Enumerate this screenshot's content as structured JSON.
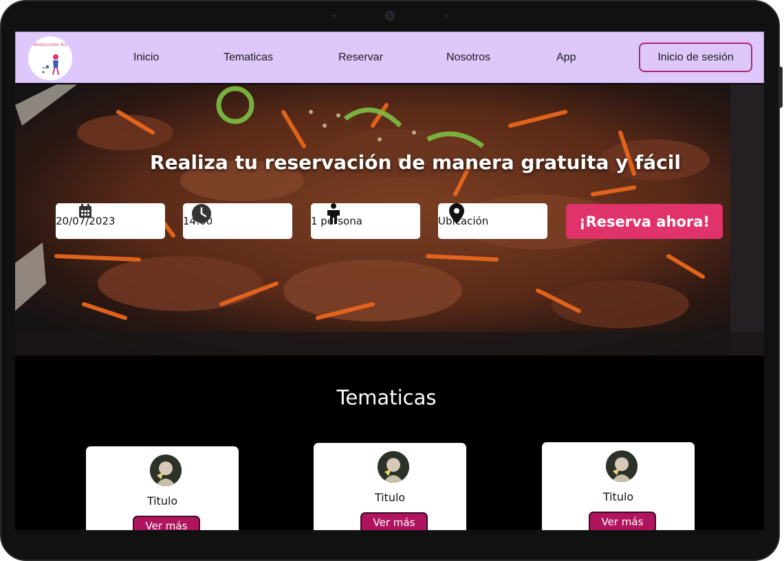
{
  "nav": {
    "logo_text": "Restaurante Sol",
    "links": [
      "Inicio",
      "Tematicas",
      "Reservar",
      "Nosotros",
      "App"
    ],
    "login_label": "Inicio de sesión"
  },
  "hero": {
    "title": "Realiza tu reservación de manera gratuita y fácil",
    "date": "20/07/2023",
    "time": "14:00",
    "people": "1 persona",
    "location": "Ubicación",
    "reserve_label": "¡Reserva ahora!",
    "icons": [
      "calendar-icon",
      "clock-icon",
      "person-icon",
      "location-pin-icon"
    ]
  },
  "tematicas": {
    "title": "Tematicas",
    "cards": [
      {
        "title": "Titulo",
        "button": "Ver más"
      },
      {
        "title": "Titulo",
        "button": "Ver más"
      },
      {
        "title": "Titulo",
        "button": "Ver más"
      }
    ]
  },
  "colors": {
    "nav_bg": "#dec8fb",
    "accent": "#e0336c",
    "card_button": "#b0145e",
    "login_border": "#b0226d",
    "page_bg": "#000000"
  }
}
